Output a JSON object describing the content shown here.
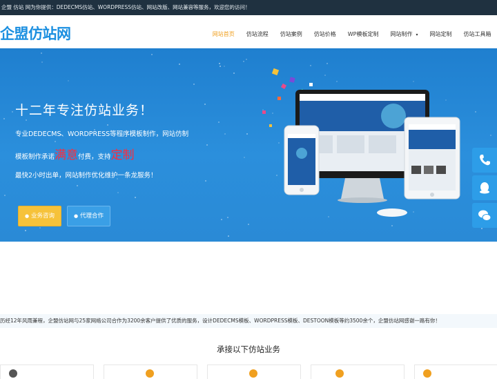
{
  "topbar": {
    "text": "企盟 仿站 网为你提供：DEDECMS仿站、WORDPRESS仿站、网站改版、网站兼容等服务，欢迎您的访问！"
  },
  "header": {
    "logo": "企盟仿站网",
    "nav": [
      {
        "label": "网站首页",
        "active": true
      },
      {
        "label": "仿站流程"
      },
      {
        "label": "仿站案例"
      },
      {
        "label": "仿站价格"
      },
      {
        "label": "WP模板定制"
      },
      {
        "label": "网站制作",
        "caret": "▾"
      },
      {
        "label": "网站定制"
      },
      {
        "label": "仿站工具箱"
      }
    ]
  },
  "banner": {
    "headline": "十二年专注仿站业务！",
    "line1": "专业DEDECMS、WORDPRESS等程序模板制作，网站仿制",
    "line2_a": "模板制作承诺",
    "line2_hl1": "满意",
    "line2_b": "付费，支持",
    "line2_hl2": "定制",
    "line3": "最快2小时出单，网站制作优化维护一条龙服务！",
    "btn_consult": "业务咨询",
    "btn_agent": "代理合作",
    "icons": {
      "consult": "chat-icon",
      "agent": "user-icon"
    }
  },
  "side": {
    "phone": "phone-icon",
    "qq": "qq-icon",
    "wechat": "wechat-icon"
  },
  "intro": {
    "text": "历经12年风雨兼程，企盟仿站网与25家网络公司合作为3200余客户提供了优质的服务，设计DEDECMS模板、WORDPRESS模板、DESTOON模板等约3500余个，企盟仿站网感谢一路有你！"
  },
  "services": {
    "title": "承接以下仿站业务"
  },
  "colors": {
    "accent": "#1b8fe0",
    "nav_active": "#f0a020",
    "banner": "#2a8ad6",
    "highlight": "#ff2a3a",
    "consult_btn": "#f6c23a",
    "topbar": "#1f3140"
  }
}
